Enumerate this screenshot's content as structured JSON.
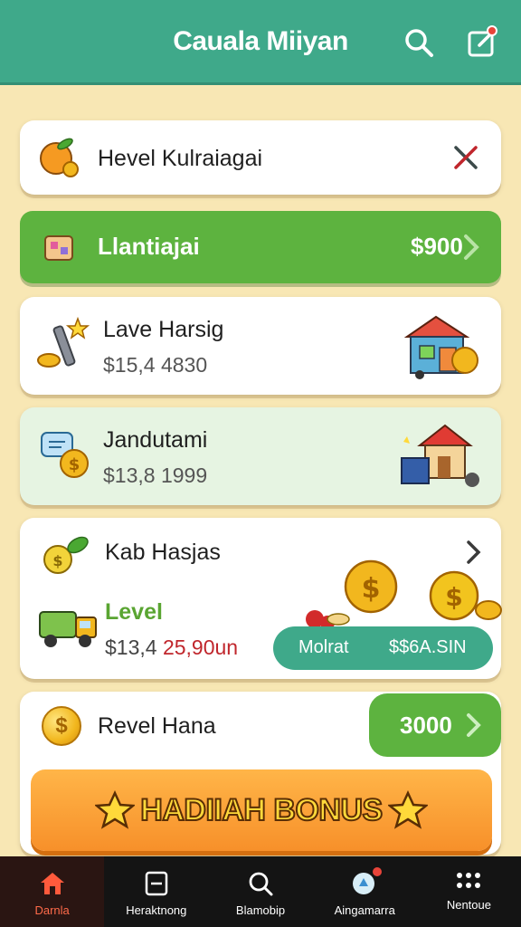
{
  "header": {
    "title": "Cauala Miiyan"
  },
  "card1": {
    "title": "Hevel Kulraiagai"
  },
  "green_bar": {
    "label": "Llantiajai",
    "amount": "$900"
  },
  "card2": {
    "title": "Lave Harsig",
    "value": "$15,4 4830"
  },
  "card3": {
    "title": "Jandutami",
    "value": "$13,8 1999"
  },
  "card4": {
    "title": "Kab Hasjas",
    "level_label": "Level",
    "value_prefix": "$13,4",
    "value_highlight": "25,90un",
    "pill_label": "Molrat",
    "pill_value": "$$6A.SIN"
  },
  "card5": {
    "title": "Revel Hana",
    "button_value": "3000"
  },
  "bonus": {
    "label": "HADIIAH BONUS"
  },
  "nav": {
    "items": [
      {
        "label": "Darnla"
      },
      {
        "label": "Heraktnong"
      },
      {
        "label": "Blamobip"
      },
      {
        "label": "Aingamarra"
      },
      {
        "label": "Nentoue"
      }
    ]
  },
  "colors": {
    "header": "#3fa98a",
    "green": "#5db33f",
    "background": "#f8e7b4",
    "accent_red": "#c0262c",
    "bonus_orange": "#f7902a"
  }
}
